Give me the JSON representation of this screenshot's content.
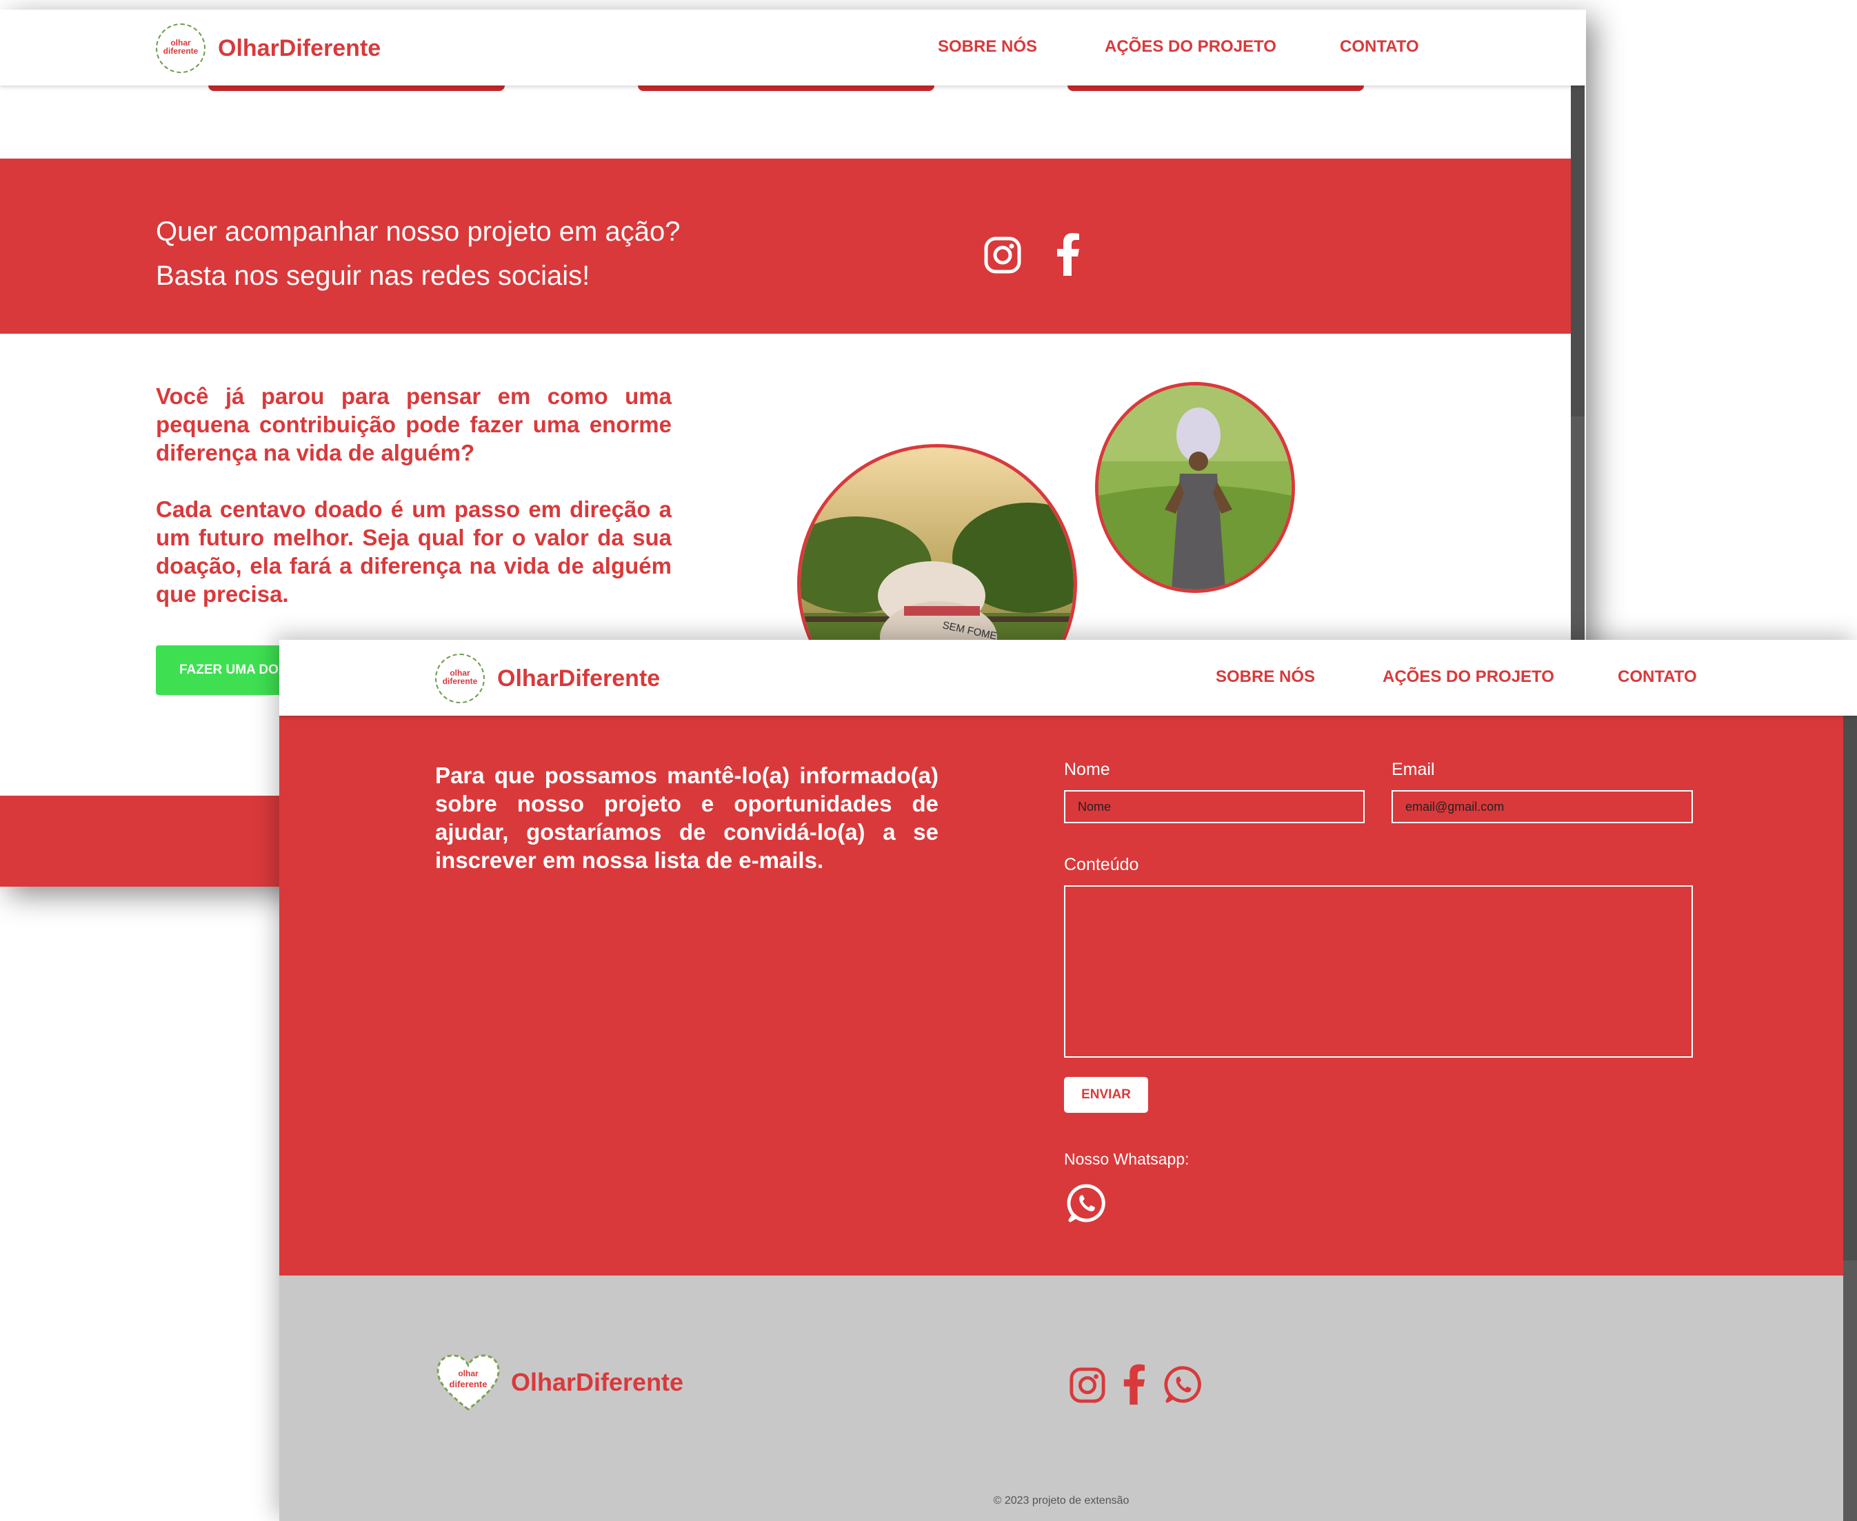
{
  "brand": {
    "name": "OlharDiferente",
    "logo_text": "olhar\ndiferente"
  },
  "nav": {
    "items": [
      "SOBRE NÓS",
      "AÇÕES DO PROJETO",
      "CONTATO"
    ]
  },
  "social": {
    "line1": "Quer acompanhar nosso projeto em ação?",
    "line2": "Basta nos seguir nas redes sociais!",
    "icons": [
      "instagram-icon",
      "facebook-icon"
    ]
  },
  "donate": {
    "paragraph1": "Você já parou para pensar em como uma pequena contribuição pode fazer uma enorme diferença na vida de alguém?",
    "paragraph2": "Cada centavo doado é um passo em direção a um futuro melhor. Seja qual for o valor da sua doação, ela fará a diferença na vida de alguém que precisa.",
    "button_label": "FAZER UMA DOAÇÃO",
    "photo_bag_text": "SEM FOME"
  },
  "contact": {
    "intro": "Para que possamos mantê-lo(a) informado(a) sobre nosso projeto e oportunidades de ajudar, gostaríamos de convidá-lo(a) a se inscrever em nossa lista de e-mails.",
    "name_label": "Nome",
    "name_placeholder": "Nome",
    "email_label": "Email",
    "email_placeholder": "email@gmail.com",
    "content_label": "Conteúdo",
    "send_label": "ENVIAR",
    "whatsapp_label": "Nosso Whatsapp:"
  },
  "footer": {
    "brand": "OlharDiferente",
    "copyright": "© 2023 projeto de extensão",
    "icons": [
      "instagram-icon",
      "facebook-icon",
      "whatsapp-icon"
    ]
  },
  "colors": {
    "primary_red": "#d9393b",
    "donate_green": "#3ee051",
    "footer_gray": "#c8c8c8"
  }
}
